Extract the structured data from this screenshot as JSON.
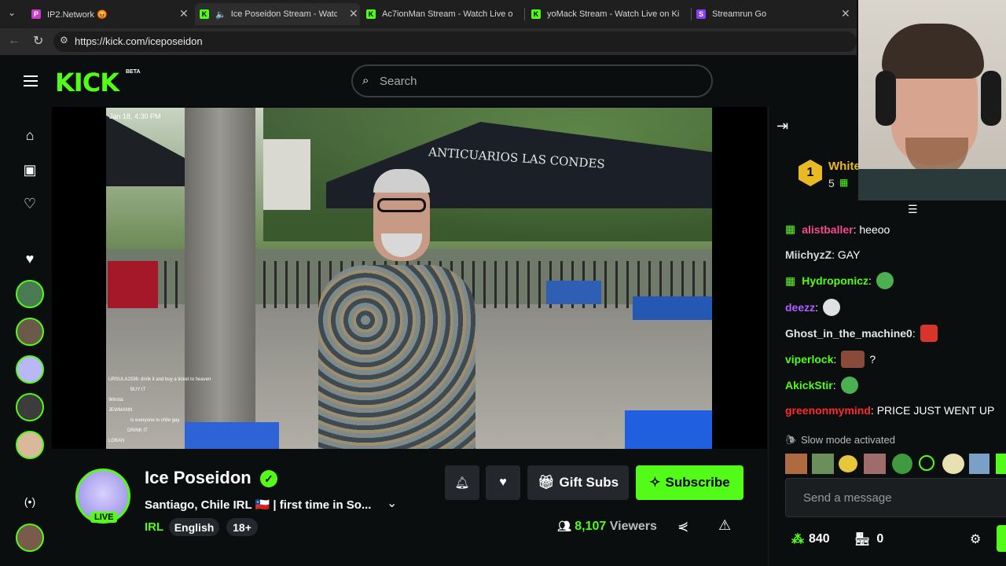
{
  "browser": {
    "tabs": [
      {
        "title": "IP2.Network 😡"
      },
      {
        "title": "Ice Poseidon Stream - Watch"
      },
      {
        "title": "Ac7ionMan Stream - Watch Live o"
      },
      {
        "title": "yoMack Stream - Watch Live on Ki"
      },
      {
        "title": "Streamrun Go"
      }
    ],
    "url": "https://kick.com/iceposeidon"
  },
  "header": {
    "logo": "KICK",
    "logo_badge": "BETA",
    "search_placeholder": "Search"
  },
  "video": {
    "timestamp": "Jan 18, 4:30 PM",
    "tent_sign": "ANTICUARIOS LAS CONDES",
    "overlay_chat": [
      "URSULA2336: drink it and buy a ticket to heaven",
      "BUY IT",
      "Winsta:",
      "JEWMANN",
      "is everyone in chile gay",
      "DRINK IT",
      "LOBAN"
    ]
  },
  "stream": {
    "name": "Ice Poseidon",
    "live_badge": "LIVE",
    "title": "Santiago, Chile IRL 🇨🇱 | first time in So...",
    "category": "IRL",
    "tags": [
      "English",
      "18+"
    ],
    "viewers_count": "8,107",
    "viewers_label": "Viewers",
    "gift_subs_label": "Gift Subs",
    "subscribe_label": "Subscribe"
  },
  "chat": {
    "top_gifter": {
      "rank": "1",
      "name": "White",
      "count": "5"
    },
    "messages": [
      {
        "user": "alistballer",
        "text": "heeoo",
        "color": "#f64a8a",
        "badge": true
      },
      {
        "user": "MiichyzZ",
        "text": "GAY",
        "color": "#d7d7d7",
        "badge": false
      },
      {
        "user": "Hydroponicz",
        "text": "",
        "color": "#53fc18",
        "badge": true
      },
      {
        "user": "deezz",
        "text": "",
        "color": "#b05cff",
        "badge": false
      },
      {
        "user": "Ghost_in_the_machine0",
        "text": "",
        "color": "#e6e6e6",
        "badge": false
      },
      {
        "user": "viperlock",
        "text": "?",
        "color": "#53fc18",
        "badge": false
      },
      {
        "user": "AkickStir",
        "text": "",
        "color": "#53fc18",
        "badge": false
      },
      {
        "user": "greenonmymind",
        "text": "PRICE JUST WENT UP",
        "color": "#ff2a2a",
        "badge": false
      }
    ],
    "slow_mode": "Slow mode activated",
    "input_placeholder": "Send a message",
    "points": "840",
    "store_count": "0"
  },
  "colors": {
    "accent": "#53fc18",
    "bg": "#0b0e0f",
    "surface": "#24272c"
  }
}
